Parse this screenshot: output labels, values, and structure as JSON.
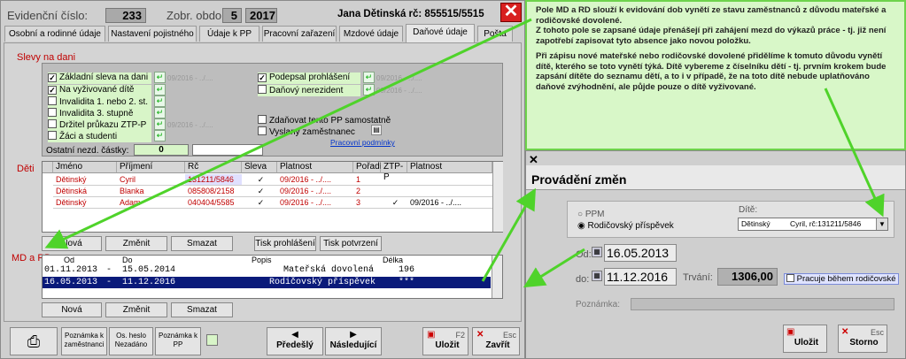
{
  "header": {
    "ev_label": "Evidenční číslo:",
    "ev_value": "233",
    "period_label": "Zobr. období:",
    "period_month": "5",
    "period_year": "2017",
    "employee": "Jana Dětinská rč: 855515/5515"
  },
  "tabs": [
    "Osobní a rodinné údaje",
    "Nastavení pojistného",
    "Údaje k PP",
    "Pracovní zařazení",
    "Mzdové údaje",
    "Daňové údaje",
    "Pošta"
  ],
  "slevy": {
    "title": "Slevy na dani",
    "items": [
      {
        "label": "Základní sleva na dani",
        "checked": "✓",
        "period": "09/2016 - ../...."
      },
      {
        "label": "Na vyživované dítě",
        "checked": "✓",
        "period": ""
      },
      {
        "label": "Invalidita 1. nebo 2. st.",
        "checked": "",
        "period": ""
      },
      {
        "label": "Invalidita 3. stupně",
        "checked": "",
        "period": ""
      },
      {
        "label": "Držitel průkazu ZTP-P",
        "checked": "",
        "period": "09/2016 - ../...."
      },
      {
        "label": "Žáci a studenti",
        "checked": "",
        "period": ""
      }
    ],
    "podepsal": "Podepsal prohlášení",
    "podepsal_checked": "✓",
    "podepsal_period": "09/2016 - ../....",
    "nerezident": "Daňový nerezident",
    "nerezident_period": "09/2016 - ../....",
    "zdanovat": "Zdaňovat tento PP samostatně",
    "vyslany": "Vyslaný zaměstnanec",
    "pracovni_podminky": "Pracovní podmínky",
    "ostatni_label": "Ostatní nezd. částky:",
    "ostatni_value": "0"
  },
  "deti": {
    "title": "Děti",
    "columns": [
      "Jméno",
      "Příjmení",
      "Rč",
      "Sleva",
      "Platnost",
      "Pořadí",
      "ZTP-P",
      "Platnost"
    ],
    "rows": [
      [
        "Dětinský",
        "Cyril",
        "131211/5846",
        "✓",
        "09/2016 - ../....",
        "1",
        "",
        ""
      ],
      [
        "Dětinská",
        "Blanka",
        "085808/2158",
        "✓",
        "09/2016 - ../....",
        "2",
        "",
        ""
      ],
      [
        "Dětinský",
        "Adam",
        "040404/5585",
        "✓",
        "09/2016 - ../....",
        "3",
        "✓",
        "09/2016 - ../...."
      ]
    ],
    "btn_new": "Nová",
    "btn_edit": "Změnit",
    "btn_delete": "Smazat",
    "btn_print_decl": "Tisk prohlášení",
    "btn_print_conf": "Tisk potvrzení"
  },
  "mdrd": {
    "title": "MD a RD",
    "columns": [
      "Od",
      "Do",
      "Popis",
      "Délka"
    ],
    "rows": [
      {
        "od": "01.11.2013",
        "sep": "-",
        "do": "15.05.2014",
        "popis": "Mateřská dovolená",
        "delka": "196"
      },
      {
        "od": "16.05.2013",
        "sep": "-",
        "do": "11.12.2016",
        "popis": "Rodičovský příspěvek",
        "delka": "***"
      }
    ],
    "btn_new": "Nová",
    "btn_edit": "Změnit",
    "btn_delete": "Smazat"
  },
  "footer": {
    "note_emp": "Poznámka k zaměstnanci",
    "hesla": "Os. heslo Nezadáno",
    "note_pp": "Poznámka k PP",
    "prev": "Předešlý",
    "next": "Následující",
    "save": "Uložit",
    "save_key": "F2",
    "close": "Zavřít",
    "close_key": "Esc"
  },
  "note": {
    "p1": "Pole MD a RD slouží k evidování dob vynětí ze stavu zaměstnanců z důvodu mateřské a rodičovské dovolené.",
    "p2": "Z tohoto pole se zapsané údaje přenášejí při zahájení mezd do výkazů práce - tj. již není zapotřebí zapisovat tyto absence jako novou položku.",
    "p3": "Při zápisu nové mateřské nebo rodičovské dovolené přidělíme k tomuto důvodu vynětí dítě, kterého se toto vynětí týká. Dítě vybereme z číselníku dětí - tj. prvním krokem bude zapsání dítěte do seznamu dětí, a to i v případě, že na toto dítě nebude uplatňováno daňové zvýhodnění, ale půjde pouze o dítě vyživované."
  },
  "dialog": {
    "title": "Provádění změn",
    "opt1": "PPM",
    "opt2": "Rodičovský příspěvek",
    "dite_label": "Dítě:",
    "dite_surname": "Dětinský",
    "dite_value": "Cyril, rč:131211/5846",
    "od_label": "Od:",
    "od_value": "16.05.2013",
    "do_label": "do:",
    "do_value": "11.12.2016",
    "trvani_label": "Trvání:",
    "trvani_value": "1306,00",
    "pracuje": "Pracuje během rodičovské",
    "poznamka_label": "Poznámka:",
    "save": "Uložit",
    "storno": "Storno",
    "esc": "Esc"
  }
}
